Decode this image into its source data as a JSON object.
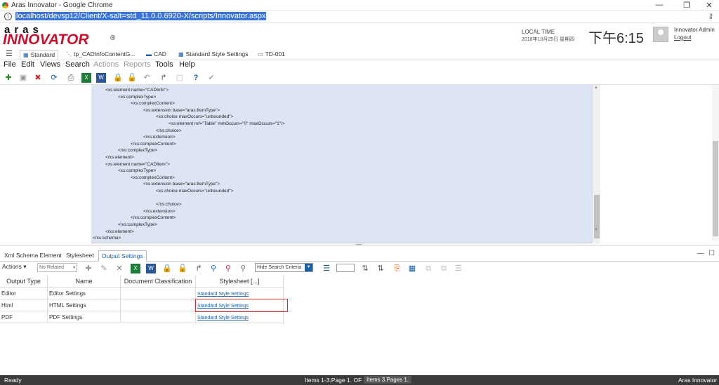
{
  "browser": {
    "title": "Aras Innovator - Google Chrome",
    "url": "localhost/devsp12/Client/X-salt=std_11.0.0.6920-X/scripts/Innovator.aspx"
  },
  "header": {
    "brand_top": "aras",
    "brand_main": "INNOVATOR",
    "reg_mark": "®",
    "local_time_label": "LOCAL TIME",
    "local_date": "2018年10月25日 星期四",
    "clock": "下午6:15",
    "user_name": "Innovator Admin",
    "logout_label": "Logout"
  },
  "tabs": [
    "Standard",
    "tp_CADInfoContentG...",
    "CAD",
    "Standard Style Settings",
    "TD-001"
  ],
  "menu": [
    "File",
    "Edit",
    "Views",
    "Search",
    "Actions",
    "Reports",
    "Tools",
    "Help"
  ],
  "xml_lines": [
    "<xs:element name=\"CADInfo\">",
    "<xs:complexType>",
    "<xs:complexContent>",
    "<xs:extension base=\"aras:ItemType\">",
    "<xs:choice maxOccurs=\"unbounded\">",
    "<xs:element ref=\"Table\" minOccurs=\"0\" maxOccurs=\"1\"/>",
    "</xs:choice>",
    "</xs:extension>",
    "</xs:complexContent>",
    "</xs:complexType>",
    "</xs:element>",
    "<xs:element name=\"CADItem\">",
    "<xs:complexType>",
    "<xs:complexContent>",
    "<xs:extension base=\"aras:ItemType\">",
    "<xs:choice maxOccurs=\"unbounded\">",
    "",
    "</xs:choice>",
    "</xs:extension>",
    "</xs:complexContent>",
    "</xs:complexType>",
    "</xs:element>",
    "</xs:schema>"
  ],
  "bottom_tabs": [
    "Xml Schema Element",
    "Stylesheet",
    "Output Settings"
  ],
  "toolbar2": {
    "actions_label": "Actions ▾",
    "related_select": "No Related",
    "search_mode": "Hide Search Criteria"
  },
  "grid": {
    "headers": [
      "Output Type",
      "Name",
      "Document Classification",
      "Stylesheet [...]"
    ],
    "rows": [
      {
        "type": "Editor",
        "name": "Editor Settings",
        "classification": "",
        "stylesheet": "Standard Style Settings"
      },
      {
        "type": "Html",
        "name": "HTML Settings",
        "classification": "",
        "stylesheet": "Standard Style Settings"
      },
      {
        "type": "PDF",
        "name": "PDF Settings",
        "classification": "",
        "stylesheet": "Standard Style Settings"
      }
    ]
  },
  "status": {
    "ready": "Ready",
    "items": "Items 1-3.Page 1. OF",
    "pages": "Items 3.Pages 1.",
    "app": "Aras Innovator"
  },
  "colors": {
    "brand_red": "#c8102e",
    "accent_blue": "#1d5fa5",
    "xml_bg": "#dde5f5"
  }
}
